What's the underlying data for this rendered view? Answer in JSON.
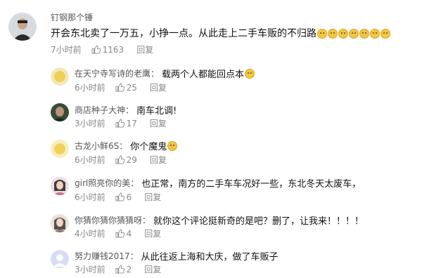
{
  "main_comment": {
    "username": "钉钢那个锤",
    "text": "开会东北卖了一万五，小挣一点。从此走上二手车贩的不归路",
    "time": "7小时前",
    "likes": "1163",
    "reply_label": "回复"
  },
  "replies": [
    {
      "username": "在天宁寺写诗的老鹰：",
      "text": "载两个人都能回点本",
      "time": "6小时前",
      "likes": "25",
      "reply_label": "回复"
    },
    {
      "username": "商店种子大神：",
      "text": "南车北调!",
      "time": "3小时前",
      "likes": "17",
      "reply_label": "回复"
    },
    {
      "username": "古龙小鲜6S：",
      "text": "你个魔鬼",
      "time": "6小时前",
      "likes": "29",
      "reply_label": "回复"
    },
    {
      "username": "girl照亮你的美：",
      "text": "也正常，南方的二手车车况好一些，东北冬天太废车，",
      "time": "6小时前",
      "likes": "6",
      "reply_label": "回复"
    },
    {
      "username": "你猜你猜你猜猜呀：",
      "text": "就你这个评论挺新奇的是吧？删了，让我来！！！！",
      "time": "4小时前",
      "likes": "4",
      "reply_label": "回复"
    },
    {
      "username": "努力赚钱2017：",
      "text": "从此往返上海和大庆，做了车贩子",
      "time": "3小时前",
      "likes": "2",
      "reply_label": "回复"
    }
  ]
}
